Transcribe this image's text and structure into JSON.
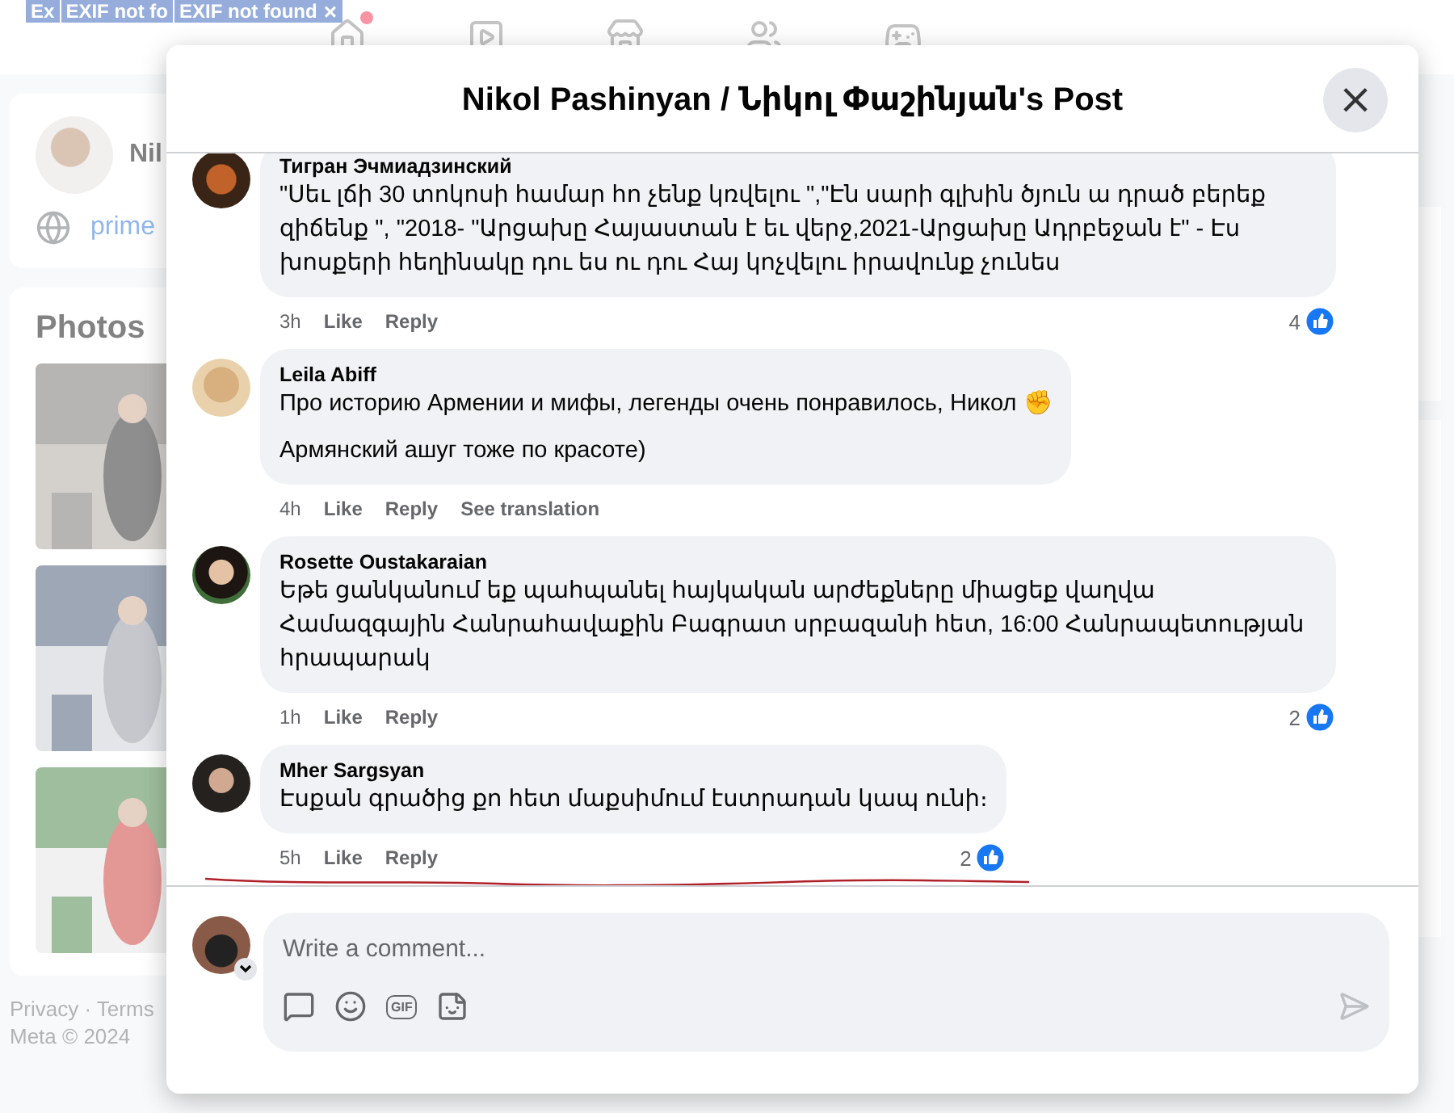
{
  "overlay_tags": [
    {
      "label": "Ex",
      "closable": false
    },
    {
      "label": "EXIF not fo",
      "closable": false
    },
    {
      "label": "EXIF not found",
      "closable": true,
      "close": "×"
    }
  ],
  "background": {
    "profile_name": "Nil",
    "link": "prime",
    "photos_title": "Photos",
    "footer_links": "Privacy · Terms",
    "copyright": "Meta © 2024"
  },
  "dialog": {
    "title": "Nikol Pashinyan / Նիկոլ Փաշինյան's Post",
    "close": "×"
  },
  "comments": [
    {
      "author": "Тигран Эчмиадзинский",
      "paragraphs": [
        "\"Սեւ լճի 30 տոկոսի համար հո չենք կռվելու \",\"Էն սարի գլխին ծյուն ա դրած բերեք զիճենք \", \"2018- \"Արցախը Հայաստան է եւ վերջ,2021-Արցախը Ադրբեջան է\" - Էս խոսքերի հեղինակը դու ես ու դու Հայ կոչվելու իրավունք չունես"
      ],
      "time": "3h",
      "actions": [
        "Like",
        "Reply"
      ],
      "reactions": "4",
      "underlined": false
    },
    {
      "author": "Leila Abiff",
      "paragraphs": [
        "Про историю Армении и мифы, легенды очень понравилось, Никол ✊",
        "Армянский ашуг тоже по красоте)"
      ],
      "time": "4h",
      "actions": [
        "Like",
        "Reply",
        "See translation"
      ],
      "underlined": false
    },
    {
      "author": "Rosette Oustakaraian",
      "paragraphs": [
        "Եթե ցանկանում եք պահպանել հայկական արժեքները միացեք վաղվա Համազգային Հանրահավաքին Բագրատ սրբազանի հետ, 16:00 Հանրապետության հրապարակ"
      ],
      "time": "1h",
      "actions": [
        "Like",
        "Reply"
      ],
      "reactions": "2",
      "underlined": false
    },
    {
      "author": "Mher Sargsyan",
      "paragraphs": [
        "Էսքան գրածից քո հետ մաքսիմում էստրադան կապ ունի։"
      ],
      "time": "5h",
      "actions": [
        "Like",
        "Reply"
      ],
      "reactions": "2",
      "underlined": true
    }
  ],
  "composer": {
    "placeholder": "Write a comment...",
    "gif_label": "GIF"
  }
}
